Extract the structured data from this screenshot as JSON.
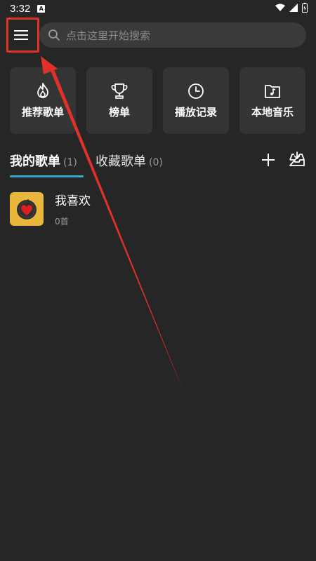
{
  "status_bar": {
    "time": "3:32",
    "notification_letter": "A"
  },
  "search": {
    "placeholder": "点击这里开始搜索"
  },
  "tiles": [
    {
      "label": "推荐歌单",
      "icon": "flame-icon"
    },
    {
      "label": "榜单",
      "icon": "trophy-icon"
    },
    {
      "label": "播放记录",
      "icon": "clock-icon"
    },
    {
      "label": "本地音乐",
      "icon": "music-folder-icon"
    }
  ],
  "tabs": {
    "my_playlists": {
      "label": "我的歌单",
      "count": "(1)"
    },
    "favorite_playlists": {
      "label": "收藏歌单",
      "count": "(0)"
    }
  },
  "playlists": [
    {
      "name": "我喜欢",
      "count": "0首"
    }
  ],
  "colors": {
    "background": "#262626",
    "tile": "#343434",
    "accent_indicator": "#3aa9c9",
    "annotation_red": "#e0312b",
    "cover_yellow": "#e8b73b"
  }
}
